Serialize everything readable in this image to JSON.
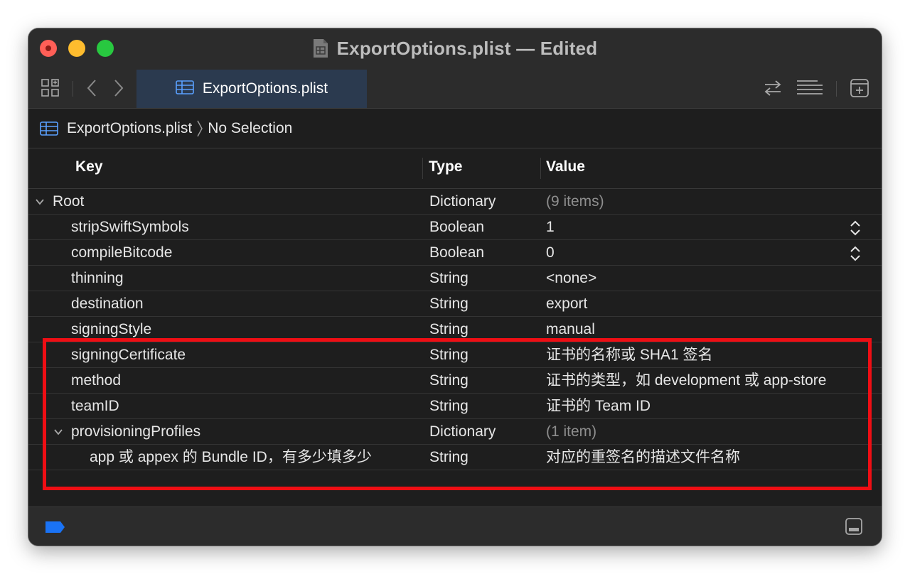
{
  "window": {
    "title": "ExportOptions.plist — Edited"
  },
  "toolbar": {
    "tab_label": "ExportOptions.plist",
    "icons": [
      "grid-icon",
      "back-icon",
      "forward-icon",
      "swap-icon",
      "lines-icon",
      "add-editor-icon"
    ]
  },
  "jumpbar": {
    "file": "ExportOptions.plist",
    "selection": "No Selection"
  },
  "columns": {
    "key": "Key",
    "type": "Type",
    "value": "Value"
  },
  "rows": [
    {
      "key": "Root",
      "type": "Dictionary",
      "value": "(9 items)",
      "indent": 0,
      "expanded": true,
      "dim": true
    },
    {
      "key": "stripSwiftSymbols",
      "type": "Boolean",
      "value": "1",
      "indent": 1,
      "stepper": true
    },
    {
      "key": "compileBitcode",
      "type": "Boolean",
      "value": "0",
      "indent": 1,
      "stepper": true
    },
    {
      "key": "thinning",
      "type": "String",
      "value": "<none>",
      "indent": 1
    },
    {
      "key": "destination",
      "type": "String",
      "value": "export",
      "indent": 1
    },
    {
      "key": "signingStyle",
      "type": "String",
      "value": "manual",
      "indent": 1
    },
    {
      "key": "signingCertificate",
      "type": "String",
      "value": "证书的名称或 SHA1 签名",
      "indent": 1
    },
    {
      "key": "method",
      "type": "String",
      "value": "证书的类型，如 development 或 app-store",
      "indent": 1
    },
    {
      "key": "teamID",
      "type": "String",
      "value": "证书的 Team ID",
      "indent": 1
    },
    {
      "key": "provisioningProfiles",
      "type": "Dictionary",
      "value": "(1 item)",
      "indent": 1,
      "expanded": true,
      "dim": true
    },
    {
      "key": "app 或 appex 的 Bundle ID，有多少填多少",
      "type": "String",
      "value": "对应的重签名的描述文件名称",
      "indent": 2
    }
  ],
  "colors": {
    "highlight": "#ef0e14",
    "tab_active": "#2b3a4f",
    "tag_blue": "#1a73f5"
  }
}
